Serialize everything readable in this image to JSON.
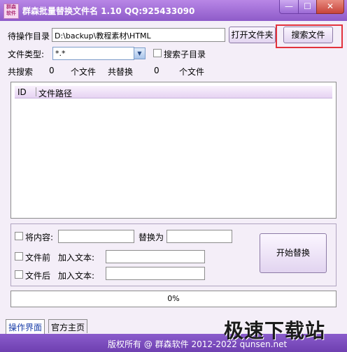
{
  "window": {
    "logo_text": "群森软件",
    "title": "群森批量替换文件名  1.10 QQ:925433090",
    "min_glyph": "—",
    "max_glyph": "☐",
    "close_glyph": "✕"
  },
  "form": {
    "dir_label": "待操作目录",
    "dir_value": "D:\\backup\\教程素材\\HTML",
    "open_folder_button": "打开文件夹",
    "search_button": "搜索文件",
    "file_type_label": "文件类型:",
    "file_type_value": "*.*",
    "search_subdir_label": "搜索子目录",
    "total_search_label": "共搜索",
    "total_search_count": "0",
    "files_unit_1": "个文件",
    "total_replace_label": "共替换",
    "total_replace_count": "0",
    "files_unit_2": "个文件"
  },
  "list": {
    "columns": [
      "ID",
      "文件路径"
    ]
  },
  "options": {
    "replace_content_label": "将内容:",
    "replace_with_label": "替换为",
    "prefix_label": "文件前",
    "prefix_add_label": "加入文本:",
    "suffix_label": "文件后",
    "suffix_add_label": "加入文本:",
    "start_button": "开始替换"
  },
  "progress": {
    "value": 0,
    "text": "0%"
  },
  "tabs": [
    "操作界面",
    "官方主页"
  ],
  "footer": {
    "copyright": "版权所有 @ 群森软件 2012-2022   qunsen.net"
  },
  "watermark": {
    "text": "极速下载站"
  }
}
